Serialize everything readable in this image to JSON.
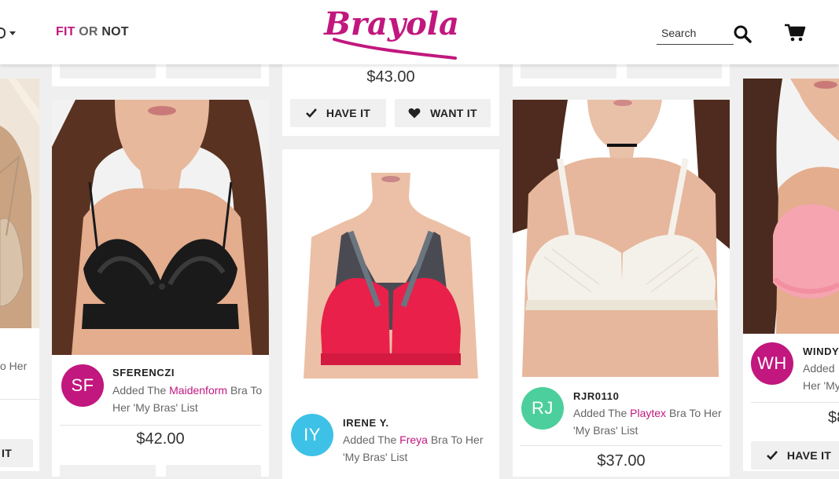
{
  "header": {
    "nav_fit": "FIT",
    "nav_or": "OR",
    "nav_not": "NOT",
    "logo_text": "Brayola",
    "search_placeholder": "Search"
  },
  "buttons": {
    "have_it": "HAVE IT",
    "want_it": "WANT IT",
    "have_it_partial": "IT"
  },
  "activity": {
    "prefix": "Added The",
    "suffix": "Bra To Her 'My Bras' List"
  },
  "feed": [
    {
      "username": "SFERENCZI",
      "initials": "SF",
      "brand": "Maidenform",
      "price": "$42.00",
      "avatar_color": "#c1177e"
    },
    {
      "username": "IRENE Y.",
      "initials": "IY",
      "brand": "Freya",
      "price": "",
      "avatar_color": "#3ec1e6"
    },
    {
      "username": "RJR0110",
      "initials": "RJ",
      "brand": "Playtex",
      "price": "$37.00",
      "avatar_color": "#4ccf9c"
    },
    {
      "username": "WINDY",
      "initials": "WH",
      "activity_partial": "Added",
      "activity_partial2": "Her 'My",
      "price_partial": "$8",
      "avatar_color": "#c1177e"
    }
  ],
  "misc": {
    "top_center_price": "$43.00",
    "left_partial_text": "o Her"
  },
  "colors": {
    "brand": "#c1177e",
    "page_bg": "#efefef"
  }
}
